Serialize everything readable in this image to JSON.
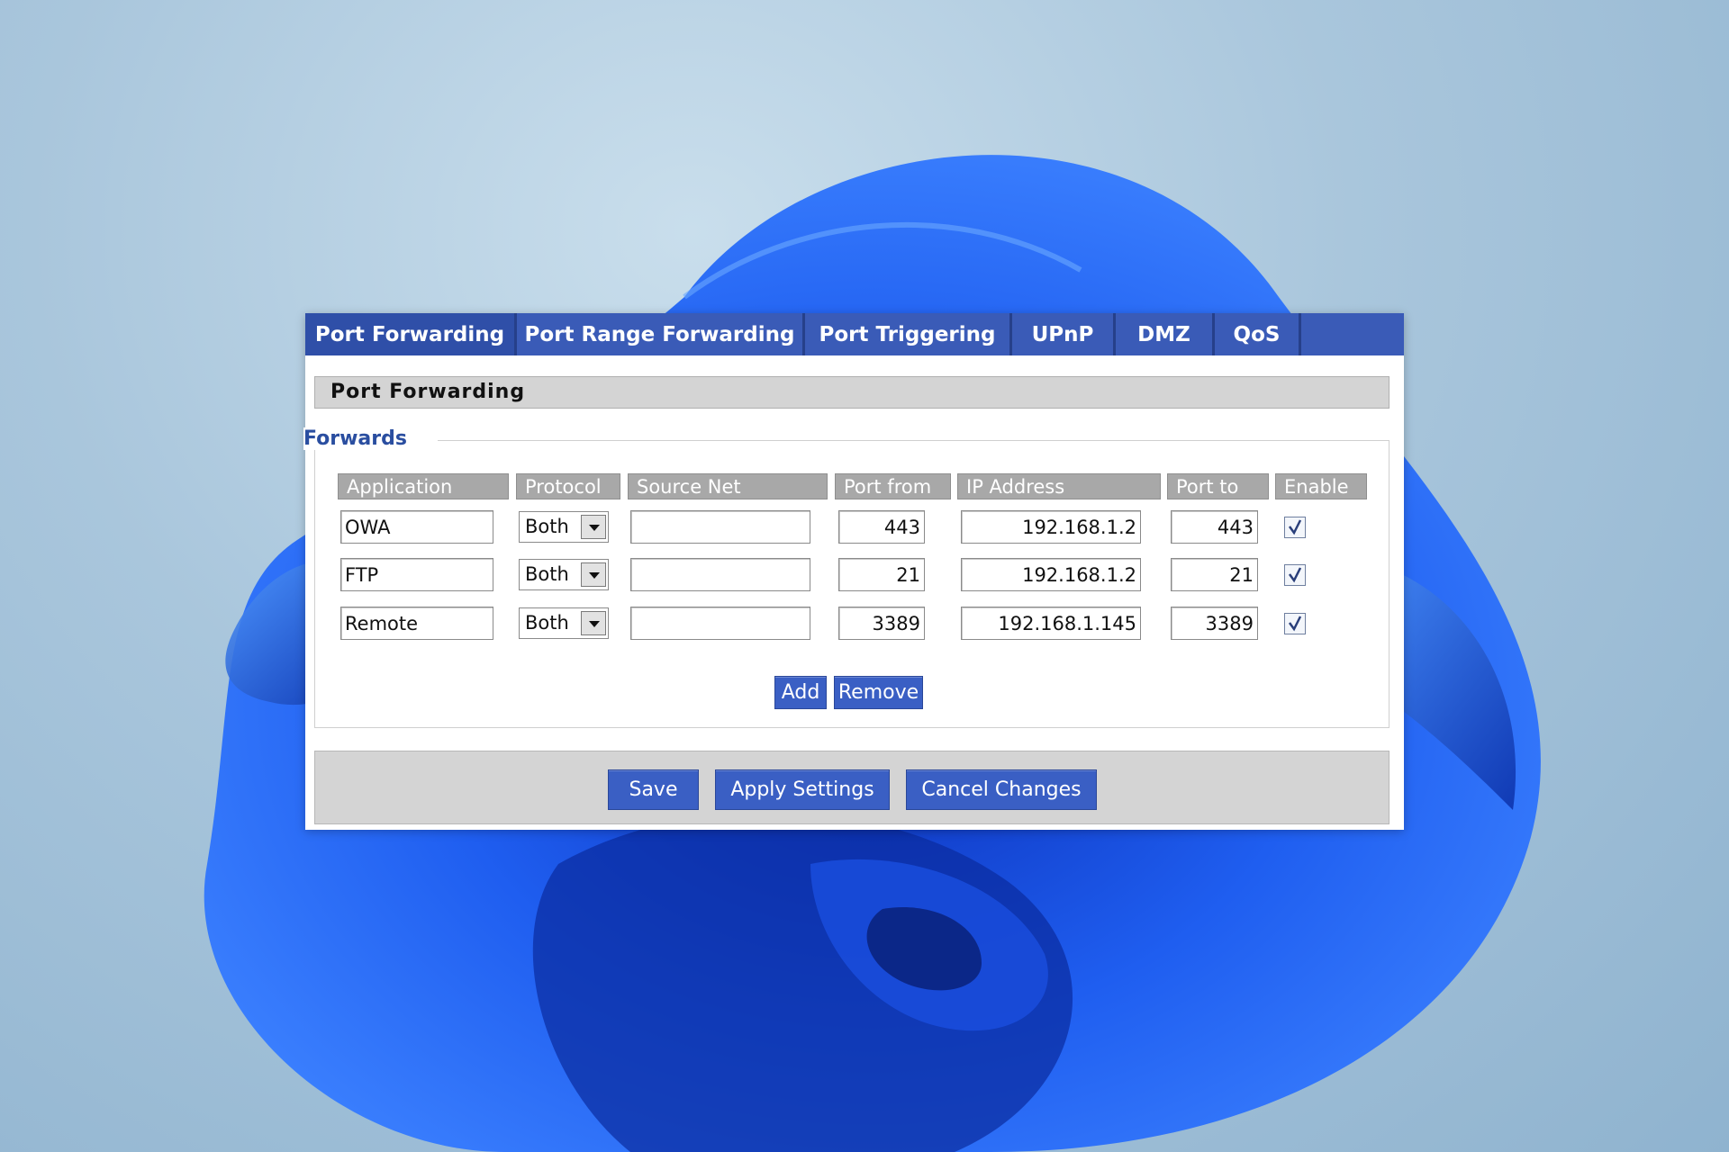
{
  "tabs": [
    {
      "label": "Port Forwarding",
      "active": true
    },
    {
      "label": "Port Range Forwarding",
      "active": false
    },
    {
      "label": "Port Triggering",
      "active": false
    },
    {
      "label": "UPnP",
      "active": false
    },
    {
      "label": "DMZ",
      "active": false
    },
    {
      "label": "QoS",
      "active": false
    }
  ],
  "section_title": "Port Forwarding",
  "legend": "Forwards",
  "columns": [
    "Application",
    "Protocol",
    "Source Net",
    "Port from",
    "IP Address",
    "Port to",
    "Enable"
  ],
  "rows": [
    {
      "application": "OWA",
      "protocol": "Both",
      "source_net": "",
      "port_from": "443",
      "ip_address": "192.168.1.2",
      "port_to": "443",
      "enabled": true
    },
    {
      "application": "FTP",
      "protocol": "Both",
      "source_net": "",
      "port_from": "21",
      "ip_address": "192.168.1.2",
      "port_to": "21",
      "enabled": true
    },
    {
      "application": "Remote",
      "protocol": "Both",
      "source_net": "",
      "port_from": "3389",
      "ip_address": "192.168.1.145",
      "port_to": "3389",
      "enabled": true
    }
  ],
  "table_buttons": {
    "add": "Add",
    "remove": "Remove"
  },
  "footer_buttons": {
    "save": "Save",
    "apply": "Apply Settings",
    "cancel": "Cancel Changes"
  },
  "colors": {
    "accent": "#3a5bb7",
    "button": "#3a5fc4",
    "header_gray": "#a8a8a8",
    "legend_text": "#2a4ea0"
  }
}
